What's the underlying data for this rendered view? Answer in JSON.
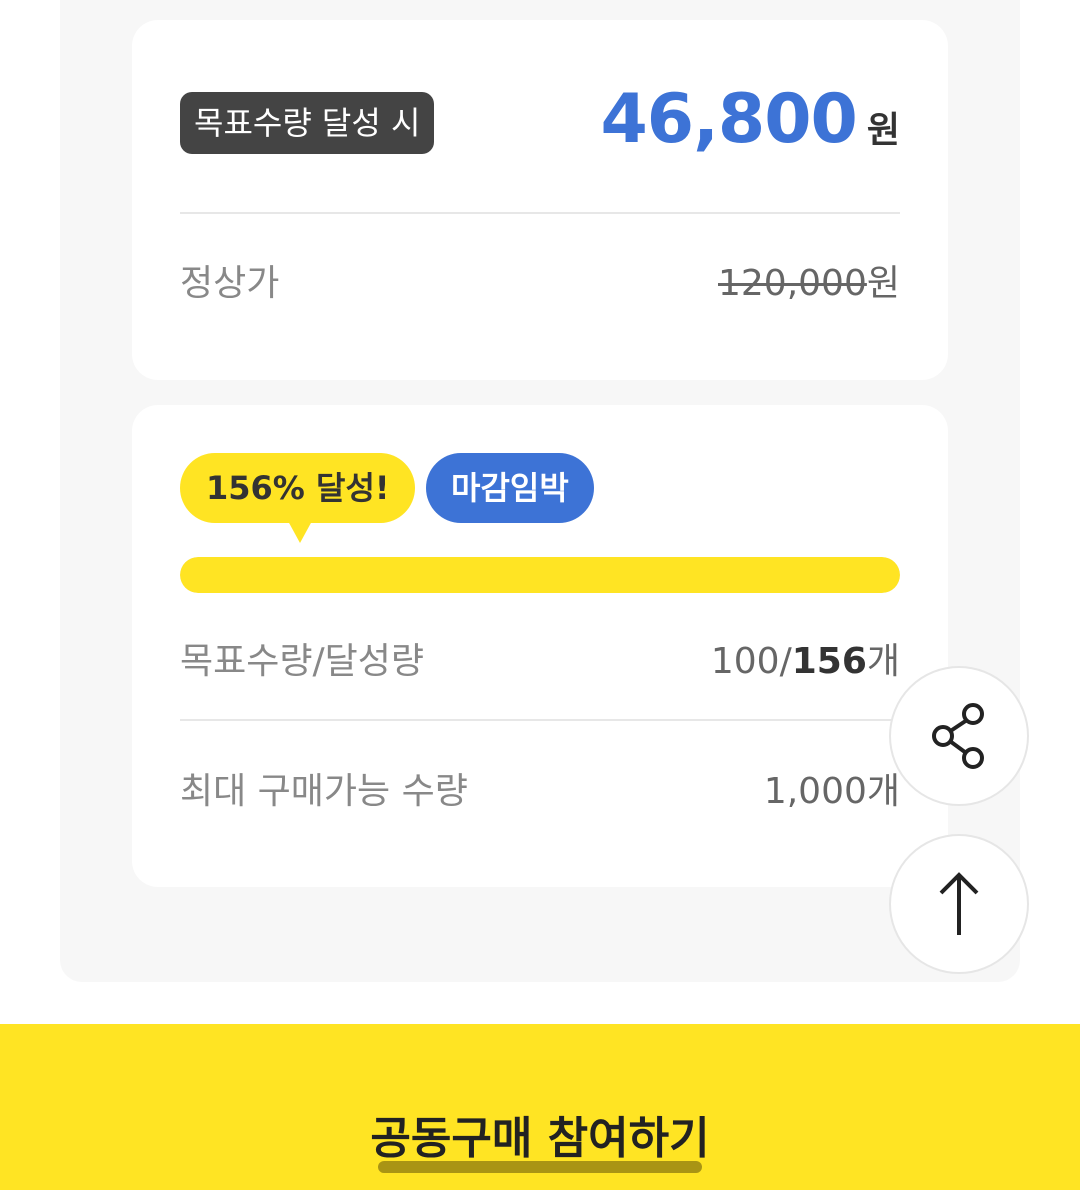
{
  "price_card": {
    "badge": "목표수량 달성 시",
    "target_price": "46,800",
    "target_currency": "원",
    "regular_label": "정상가",
    "regular_price": "120,000",
    "regular_currency": "원"
  },
  "progress_card": {
    "achieved_badge": "156% 달성!",
    "deadline_badge": "마감임박",
    "progress_fraction": 1.0,
    "target_label": "목표수량/달성량",
    "target_value": "100/",
    "achieved_value": "156",
    "count_unit": "개",
    "max_label": "최대 구매가능 수량",
    "max_value": "1,000개"
  },
  "floating_buttons": {
    "share_icon": "share-icon",
    "scroll_top_icon": "arrow-up-icon"
  },
  "cta": {
    "label": "공동구매 참여하기"
  },
  "colors": {
    "accent_yellow": "#ffe423",
    "accent_blue": "#3d73d6",
    "dark_badge": "#444444"
  }
}
